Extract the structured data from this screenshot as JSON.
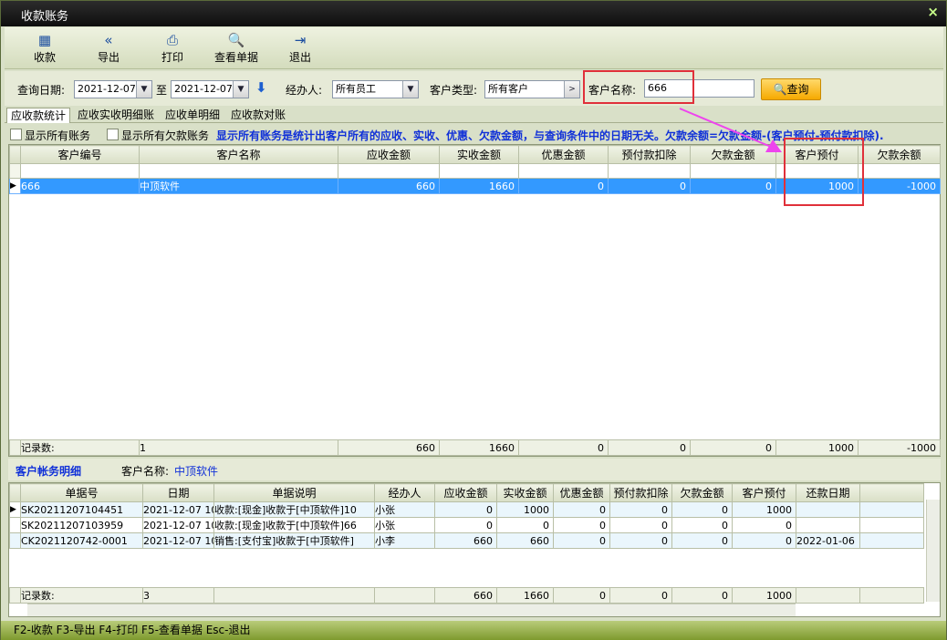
{
  "window": {
    "title": "收款账务",
    "close": "×"
  },
  "toolbar": [
    {
      "label": "收款",
      "icon": "receipt-icon"
    },
    {
      "label": "导出",
      "icon": "export-icon"
    },
    {
      "label": "打印",
      "icon": "print-icon"
    },
    {
      "label": "查看单据",
      "icon": "view-doc-icon"
    },
    {
      "label": "退出",
      "icon": "exit-icon"
    }
  ],
  "filter": {
    "date_label": "查询日期:",
    "date_from": "2021-12-07",
    "to_label": "至",
    "date_to": "2021-12-07",
    "handler_label": "经办人:",
    "handler_value": "所有员工",
    "ctype_label": "客户类型:",
    "ctype_value": "所有客户",
    "cname_label": "客户名称:",
    "cname_value": "666",
    "query_button": "查询"
  },
  "tabs": [
    "应收款统计",
    "应收实收明细账",
    "应收单明细",
    "应收款对账"
  ],
  "options": {
    "show_all": "显示所有账务",
    "show_debt": "显示所有欠款账务",
    "note": "显示所有账务是统计出客户所有的应收、实收、优惠、欠款金额，与查询条件中的日期无关。欠款余额=欠款金额-(客户预付-预付款扣除)."
  },
  "main_table": {
    "columns": [
      "客户编号",
      "客户名称",
      "应收金额",
      "实收金额",
      "优惠金额",
      "预付款扣除",
      "欠款金额",
      "客户预付",
      "欠款余额"
    ],
    "rows": [
      [
        "666",
        "中顶软件",
        "660",
        "1660",
        "0",
        "0",
        "0",
        "1000",
        "-1000"
      ]
    ],
    "footer": [
      "记录数:",
      "1",
      "660",
      "1660",
      "0",
      "0",
      "0",
      "1000",
      "-1000"
    ]
  },
  "detail": {
    "title": "客户帐务明细",
    "cname_label": "客户名称:",
    "cname_value": "中顶软件",
    "columns": [
      "单据号",
      "日期",
      "单据说明",
      "经办人",
      "应收金额",
      "实收金额",
      "优惠金额",
      "预付款扣除",
      "欠款金额",
      "客户预付",
      "还款日期"
    ],
    "rows": [
      [
        "SK20211207104451",
        "2021-12-07 10",
        "收款:[现金]收款于[中顶软件]10",
        "小张",
        "0",
        "1000",
        "0",
        "0",
        "0",
        "1000",
        ""
      ],
      [
        "SK20211207103959",
        "2021-12-07 10",
        "收款:[现金]收款于[中顶软件]66",
        "小张",
        "0",
        "0",
        "0",
        "0",
        "0",
        "0",
        ""
      ],
      [
        "CK2021120742-0001",
        "2021-12-07 10",
        "销售:[支付宝]收款于[中顶软件]",
        "小李",
        "660",
        "660",
        "0",
        "0",
        "0",
        "0",
        "2022-01-06"
      ]
    ],
    "footer": [
      "记录数:",
      "3",
      "",
      "",
      "660",
      "1660",
      "0",
      "0",
      "0",
      "1000",
      ""
    ]
  },
  "statusbar": "F2-收款 F3-导出 F4-打印 F5-查看单据 Esc-退出",
  "colors": {
    "accent": "#3399ff",
    "note": "#1030d8",
    "highlight": "#e0303a",
    "arrow": "#ee44ee"
  }
}
